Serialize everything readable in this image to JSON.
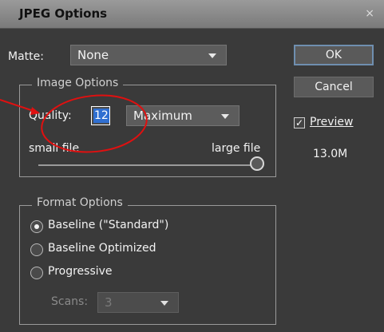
{
  "window": {
    "title": "JPEG Options",
    "close_glyph": "×"
  },
  "matte": {
    "label": "Matte:",
    "value": "None"
  },
  "image_options": {
    "legend": "Image Options",
    "quality_label": "Quality:",
    "quality_value": "12",
    "quality_preset": "Maximum",
    "small_file_label": "small file",
    "large_file_label": "large file",
    "slider_level": 1.0
  },
  "format_options": {
    "legend": "Format Options",
    "options": [
      "Baseline (\"Standard\")",
      "Baseline Optimized",
      "Progressive"
    ],
    "selected_index": 0,
    "scans_label": "Scans:",
    "scans_value": "3"
  },
  "buttons": {
    "ok": "OK",
    "cancel": "Cancel"
  },
  "preview": {
    "label": "Preview",
    "checked": true,
    "size": "13.0M"
  },
  "colors": {
    "annotation": "#e01010",
    "dialog_bg": "#3a3a3a",
    "title_bar": "#8a8a8a"
  }
}
